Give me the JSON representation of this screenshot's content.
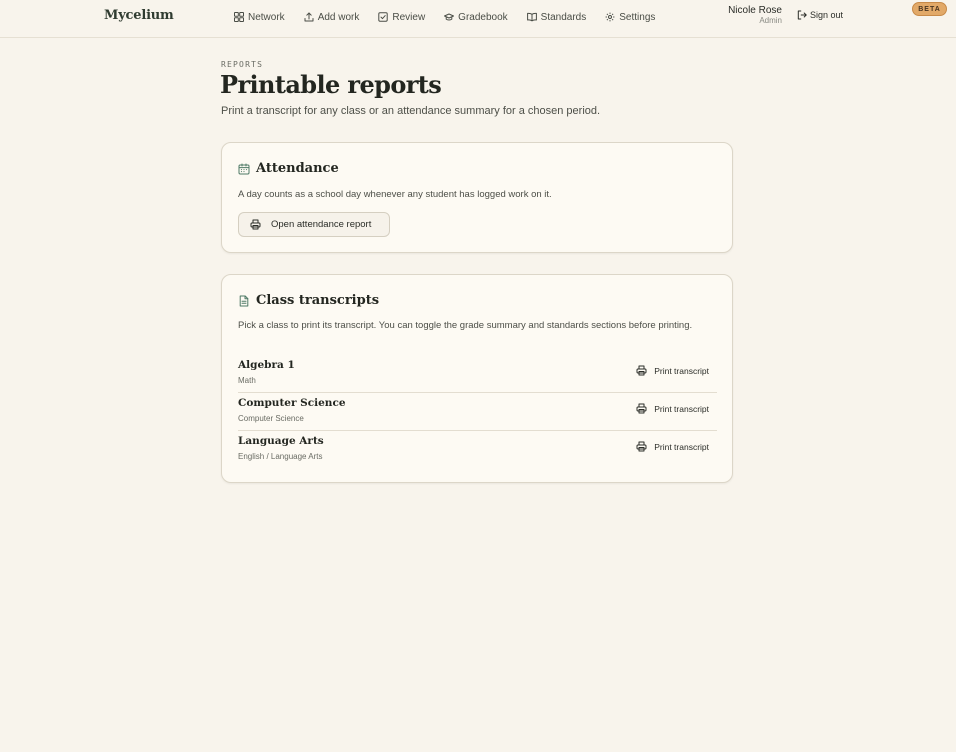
{
  "header": {
    "brand": "Mycelium",
    "nav": [
      {
        "label": "Network",
        "icon": "grid-icon"
      },
      {
        "label": "Add work",
        "icon": "upload-icon"
      },
      {
        "label": "Review",
        "icon": "checkbox-icon"
      },
      {
        "label": "Gradebook",
        "icon": "graduation-cap-icon"
      },
      {
        "label": "Standards",
        "icon": "book-open-icon"
      },
      {
        "label": "Settings",
        "icon": "gear-icon"
      }
    ],
    "user": {
      "name": "Nicole Rose",
      "role": "Admin"
    },
    "signout_label": "Sign out",
    "beta_label": "BETA"
  },
  "page": {
    "eyebrow": "REPORTS",
    "title": "Printable reports",
    "description": "Print a transcript for any class or an attendance summary for a chosen period."
  },
  "attendance": {
    "title": "Attendance",
    "description": "A day counts as a school day whenever any student has logged work on it.",
    "button_label": "Open attendance report"
  },
  "transcripts": {
    "title": "Class transcripts",
    "description": "Pick a class to print its transcript. You can toggle the grade summary and standards sections before printing.",
    "rows": [
      {
        "name": "Algebra 1",
        "subject": "Math",
        "action": "Print transcript"
      },
      {
        "name": "Computer Science",
        "subject": "Computer Science",
        "action": "Print transcript"
      },
      {
        "name": "Language Arts",
        "subject": "English / Language Arts",
        "action": "Print transcript"
      }
    ]
  },
  "colors": {
    "background": "#f8f4ec",
    "card": "#fdfaf3",
    "accent_beta": "#e2a968",
    "text": "#232620"
  }
}
